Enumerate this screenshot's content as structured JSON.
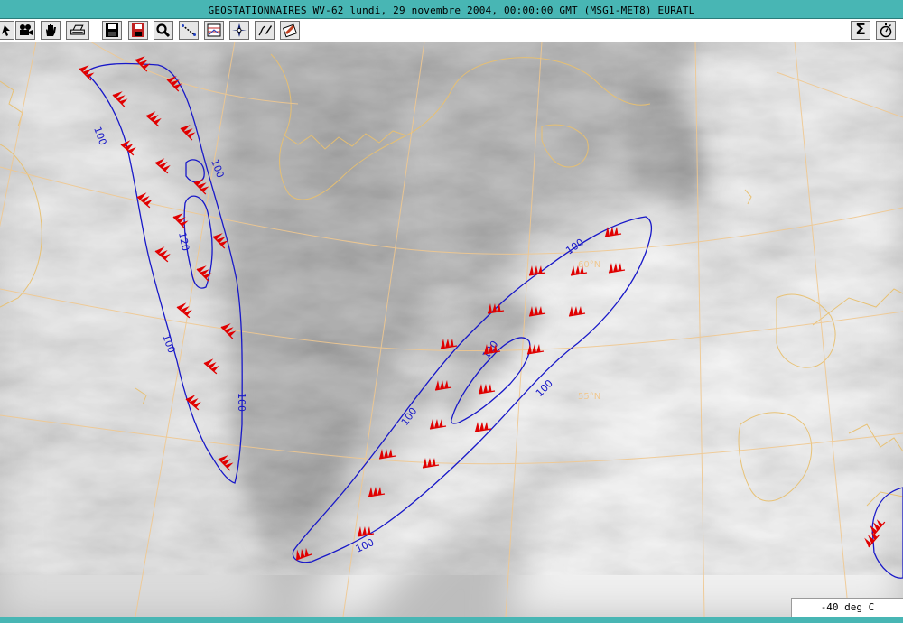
{
  "window": {
    "title": "GEOSTATIONNAIRES WV-62 lundi, 29 novembre 2004, 00:00:00 GMT (MSG1-MET8) EURATL"
  },
  "toolbar": {
    "tools": [
      {
        "name": "pointer-tool",
        "icon": "pointer-icon"
      },
      {
        "name": "camera-tool",
        "icon": "camera-icon"
      },
      {
        "name": "pan-tool",
        "icon": "hand-icon"
      },
      {
        "name": "print-tool",
        "icon": "printer-icon"
      },
      {
        "name": "save-tool",
        "icon": "floppy-icon"
      },
      {
        "name": "save-as-tool",
        "icon": "floppy-red-icon"
      },
      {
        "name": "zoom-tool",
        "icon": "magnifier-icon"
      },
      {
        "name": "measure-tool",
        "icon": "ruler-icon"
      },
      {
        "name": "layers-tool",
        "icon": "layers-icon"
      },
      {
        "name": "navigate-tool",
        "icon": "compass-icon"
      },
      {
        "name": "draw-tool",
        "icon": "pen-icon"
      },
      {
        "name": "erase-tool",
        "icon": "eraser-icon"
      },
      {
        "name": "sum-tool",
        "icon": "sigma-icon",
        "glyph": "Σ"
      },
      {
        "name": "timer-tool",
        "icon": "stopwatch-icon"
      }
    ]
  },
  "map": {
    "contour_color": "#1818c8",
    "barb_color": "#e00000",
    "grid_color": "#f0c890",
    "coast_color": "#e8c070",
    "contour_labels": [
      "100",
      "100",
      "120",
      "100",
      "100",
      "100",
      "100",
      "120",
      "100",
      "100"
    ],
    "latitude_labels": [
      "60°N",
      "55°N"
    ]
  },
  "legend": {
    "label": "-40 deg C"
  }
}
